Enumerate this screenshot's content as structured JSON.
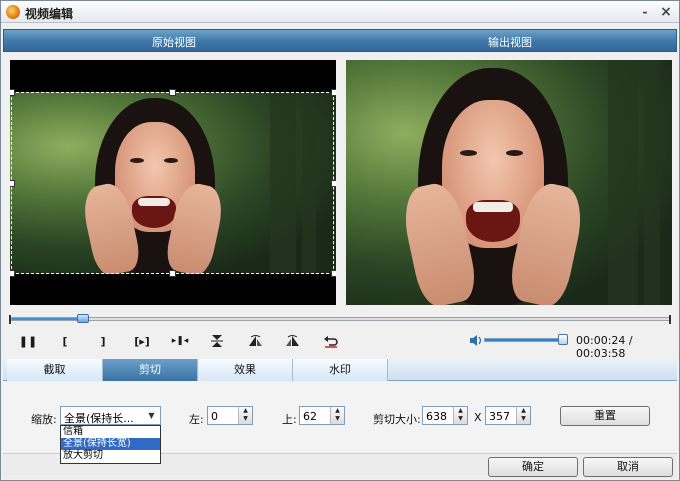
{
  "window": {
    "title": "视频编辑",
    "minimize_label": "-",
    "close_label": "×"
  },
  "viewbar": {
    "original_label": "原始视图",
    "output_label": "输出视图"
  },
  "player": {
    "time_display": "00:00:24 / 00:03:58",
    "seek_progress": 0.107,
    "volume_level": 0.95,
    "buttons": {
      "pause": "❚❚",
      "mark_in": "[",
      "mark_out": "]",
      "next_frame": "[▸]",
      "skip_end": "▸❚◂",
      "trim": "⏎"
    }
  },
  "tabs": [
    {
      "label": "截取",
      "active": false
    },
    {
      "label": "剪切",
      "active": true
    },
    {
      "label": "效果",
      "active": false
    },
    {
      "label": "水印",
      "active": false
    }
  ],
  "crop_panel": {
    "zoom_label": "缩放:",
    "zoom_value": "全景(保持长...",
    "zoom_options": [
      "信箱",
      "全景(保持长宽)",
      "放大剪切"
    ],
    "zoom_selected_index": 1,
    "left_label": "左:",
    "left_value": "0",
    "top_label": "上:",
    "top_value": "62",
    "size_label": "剪切大小:",
    "width_value": "638",
    "size_sep": "X",
    "height_value": "357",
    "reset_label": "重置"
  },
  "footer": {
    "ok_label": "确定",
    "cancel_label": "取消"
  },
  "icons": {
    "app": "app-logo-icon",
    "volume": "speaker-icon",
    "dropdown": "chevron-down-icon"
  },
  "colors": {
    "accent_blue": "#3E77A7",
    "selection_blue": "#316AC5",
    "progress_blue": "#3d8fd6"
  }
}
